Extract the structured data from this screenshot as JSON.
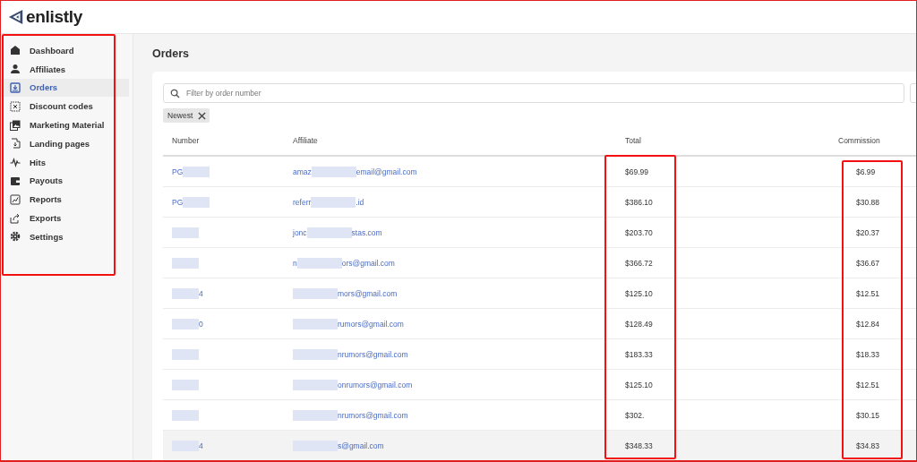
{
  "brand": {
    "name": "enlistly"
  },
  "annotations": {
    "sidebar_boxed": true,
    "total_column_boxed": true,
    "commission_column_boxed": true
  },
  "sidebar": {
    "items": [
      {
        "label": "Dashboard",
        "selected": false
      },
      {
        "label": "Affiliates",
        "selected": false
      },
      {
        "label": "Orders",
        "selected": true
      },
      {
        "label": "Discount codes",
        "selected": false
      },
      {
        "label": "Marketing Material",
        "selected": false
      },
      {
        "label": "Landing pages",
        "selected": false
      },
      {
        "label": "Hits",
        "selected": false
      },
      {
        "label": "Payouts",
        "selected": false
      },
      {
        "label": "Reports",
        "selected": false
      },
      {
        "label": "Exports",
        "selected": false
      },
      {
        "label": "Settings",
        "selected": false
      }
    ]
  },
  "page": {
    "title": "Orders"
  },
  "search": {
    "placeholder": "Filter by order number"
  },
  "filter_chip": {
    "label": "Newest"
  },
  "table": {
    "columns": [
      {
        "label": "Number"
      },
      {
        "label": "Affiliate"
      },
      {
        "label": "Total"
      },
      {
        "label": "Commission"
      }
    ],
    "rows": [
      {
        "number": {
          "start": "PG"
        },
        "affiliate": {
          "start": "amaz",
          "end": "email@gmail.com"
        },
        "total": "$69.99",
        "commission": "$6.99",
        "hovered": false
      },
      {
        "number": {
          "start": "PG"
        },
        "affiliate": {
          "start": "referr",
          "end": ".id"
        },
        "total": "$386.10",
        "commission": "$30.88",
        "hovered": false
      },
      {
        "number": {},
        "affiliate": {
          "start": "jonc",
          "end": "stas.com"
        },
        "total": "$203.70",
        "commission": "$20.37",
        "hovered": false
      },
      {
        "number": {},
        "affiliate": {
          "start": "n",
          "end": "ors@gmail.com"
        },
        "total": "$366.72",
        "commission": "$36.67",
        "hovered": false
      },
      {
        "number": {
          "end": "4"
        },
        "affiliate": {
          "end": "mors@gmail.com"
        },
        "total": "$125.10",
        "commission": "$12.51",
        "hovered": false
      },
      {
        "number": {
          "end": "0"
        },
        "affiliate": {
          "end": "rumors@gmail.com"
        },
        "total": "$128.49",
        "commission": "$12.84",
        "hovered": false
      },
      {
        "number": {},
        "affiliate": {
          "end": "nrumors@gmail.com"
        },
        "total": "$183.33",
        "commission": "$18.33",
        "hovered": false
      },
      {
        "number": {},
        "affiliate": {
          "end": "onrumors@gmail.com"
        },
        "total": "$125.10",
        "commission": "$12.51",
        "hovered": false
      },
      {
        "number": {},
        "affiliate": {
          "end": "nrumors@gmail.com"
        },
        "total": "$302.",
        "commission": "$30.15",
        "hovered": false
      },
      {
        "number": {
          "end": "4"
        },
        "affiliate": {
          "end": "s@gmail.com"
        },
        "total": "$348.33",
        "commission": "$34.83",
        "hovered": true
      }
    ]
  }
}
